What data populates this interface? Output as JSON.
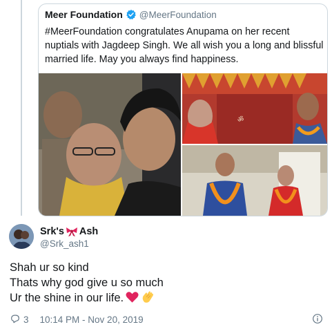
{
  "quoted_tweet": {
    "name": "Meer Foundation",
    "handle": "@MeerFoundation",
    "lines": [
      "#MeerFoundation congratulates Anupama on her recent",
      "nuptials with Jagdeep Singh. We all wish you a long and blissful",
      "married life. May you always find happiness."
    ]
  },
  "reply": {
    "name_part1": "Srk's",
    "name_part2": "Ash",
    "handle": "@Srk_ash1",
    "lines": [
      "Shah ur so kind",
      "Thats why god give u so much",
      "Ur the shine in our life."
    ]
  },
  "footer": {
    "reply_count": "3",
    "timestamp": "10:14 PM - Nov 20, 2019"
  },
  "colors": {
    "text": "#14171a",
    "secondary": "#657786",
    "border": "#ccd6dd",
    "verified": "#1da1f2",
    "heart": "#e0245e"
  },
  "icons": [
    "verified-badge-icon",
    "ribbon-bow-icon",
    "red-heart-icon",
    "clapping-hands-icon",
    "reply-icon",
    "info-icon"
  ]
}
